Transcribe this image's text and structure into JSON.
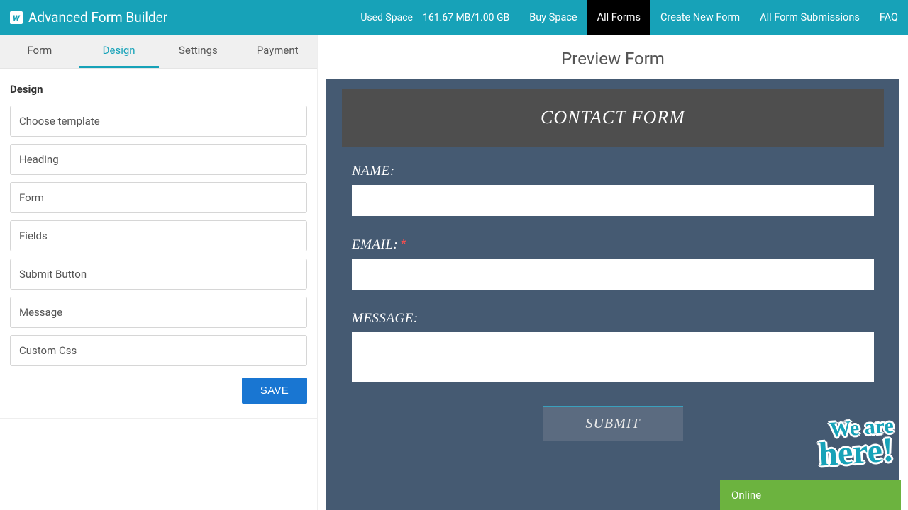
{
  "topbar": {
    "logo_text": "Advanced Form Builder",
    "logo_glyph": "w",
    "used_space_label": "Used Space",
    "used_space_value": "161.67 MB/1.00 GB",
    "nav": {
      "buy_space": "Buy Space",
      "all_forms": "All Forms",
      "create_new_form": "Create New Form",
      "all_form_submissions": "All Form Submissions",
      "faq": "FAQ"
    }
  },
  "tabs": {
    "form": "Form",
    "design": "Design",
    "settings": "Settings",
    "payment": "Payment"
  },
  "design_panel": {
    "heading": "Design",
    "items": {
      "choose_template": "Choose template",
      "heading": "Heading",
      "form": "Form",
      "fields": "Fields",
      "submit_button": "Submit Button",
      "message": "Message",
      "custom_css": "Custom Css"
    },
    "save_label": "SAVE"
  },
  "preview": {
    "title": "Preview Form",
    "form_title": "CONTACT FORM",
    "fields": {
      "name_label": "NAME:",
      "email_label": "EMAIL:",
      "required_mark": "*",
      "message_label": "MESSAGE:"
    },
    "submit_label": "SUBMIT"
  },
  "chat": {
    "badge_line1": "We are",
    "badge_line2": "here!",
    "status": "Online"
  }
}
